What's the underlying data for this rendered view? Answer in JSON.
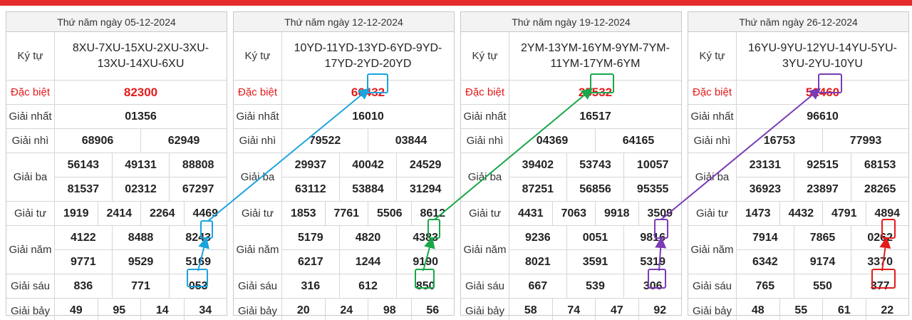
{
  "labels": {
    "ky_tu": "Ký tự",
    "dac_biet": "Đặc biệt",
    "giai_nhat": "Giải nhất",
    "giai_nhi": "Giải nhì",
    "giai_ba": "Giải ba",
    "giai_tu": "Giải tư",
    "giai_nam": "Giải năm",
    "giai_sau": "Giải sáu",
    "giai_bay": "Giải bảy"
  },
  "boards": [
    {
      "date": "Thứ năm ngày 05-12-2024",
      "code": "8XU-7XU-15XU-2XU-3XU-13XU-14XU-6XU",
      "dac_biet": "82300",
      "nhat": "01356",
      "nhi": [
        "68906",
        "62949"
      ],
      "ba": [
        [
          "56143",
          "49131",
          "88808"
        ],
        [
          "81537",
          "02312",
          "67297"
        ]
      ],
      "tu": [
        "1919",
        "2414",
        "2264",
        "4469"
      ],
      "nam": [
        [
          "4122",
          "8488",
          "8243"
        ],
        [
          "9771",
          "9529",
          "5169"
        ]
      ],
      "sau": [
        "836",
        "771",
        "053"
      ],
      "bay": [
        "49",
        "95",
        "14",
        "34"
      ]
    },
    {
      "date": "Thứ năm ngày 12-12-2024",
      "code": "10YD-11YD-13YD-6YD-9YD-17YD-2YD-20YD",
      "dac_biet": "66432",
      "nhat": "16010",
      "nhi": [
        "79522",
        "03844"
      ],
      "ba": [
        [
          "29937",
          "40042",
          "24529"
        ],
        [
          "63112",
          "53884",
          "31294"
        ]
      ],
      "tu": [
        "1853",
        "7761",
        "5506",
        "8612"
      ],
      "nam": [
        [
          "5179",
          "4820",
          "4383"
        ],
        [
          "6217",
          "1244",
          "9190"
        ]
      ],
      "sau": [
        "316",
        "612",
        "850"
      ],
      "bay": [
        "20",
        "24",
        "98",
        "56"
      ]
    },
    {
      "date": "Thứ năm ngày 19-12-2024",
      "code": "2YM-13YM-16YM-9YM-7YM-11YM-17YM-6YM",
      "dac_biet": "25532",
      "nhat": "16517",
      "nhi": [
        "04369",
        "64165"
      ],
      "ba": [
        [
          "39402",
          "53743",
          "10057"
        ],
        [
          "87251",
          "56856",
          "95355"
        ]
      ],
      "tu": [
        "4431",
        "7063",
        "9918",
        "3509"
      ],
      "nam": [
        [
          "9236",
          "0051",
          "9816"
        ],
        [
          "8021",
          "3591",
          "5319"
        ]
      ],
      "sau": [
        "667",
        "539",
        "306"
      ],
      "bay": [
        "58",
        "74",
        "47",
        "92"
      ]
    },
    {
      "date": "Thứ năm ngày 26-12-2024",
      "code": "16YU-9YU-12YU-14YU-5YU-3YU-2YU-10YU",
      "dac_biet": "52460",
      "nhat": "96610",
      "nhi": [
        "16753",
        "77993"
      ],
      "ba": [
        [
          "23131",
          "92515",
          "68153"
        ],
        [
          "36923",
          "23897",
          "28265"
        ]
      ],
      "tu": [
        "1473",
        "4432",
        "4791",
        "4894"
      ],
      "nam": [
        [
          "7914",
          "7865",
          "0262"
        ],
        [
          "6342",
          "9174",
          "3370"
        ]
      ],
      "sau": [
        "765",
        "550",
        "377"
      ],
      "bay": [
        "48",
        "55",
        "61",
        "22"
      ]
    }
  ],
  "colors": {
    "topbar": "#e52b2b",
    "special_text": "#e31b1b",
    "arrow_blue": "#1aa3e0",
    "arrow_green": "#18a84a",
    "arrow_purple": "#7a3bb5",
    "arrow_red": "#e31b1b"
  }
}
